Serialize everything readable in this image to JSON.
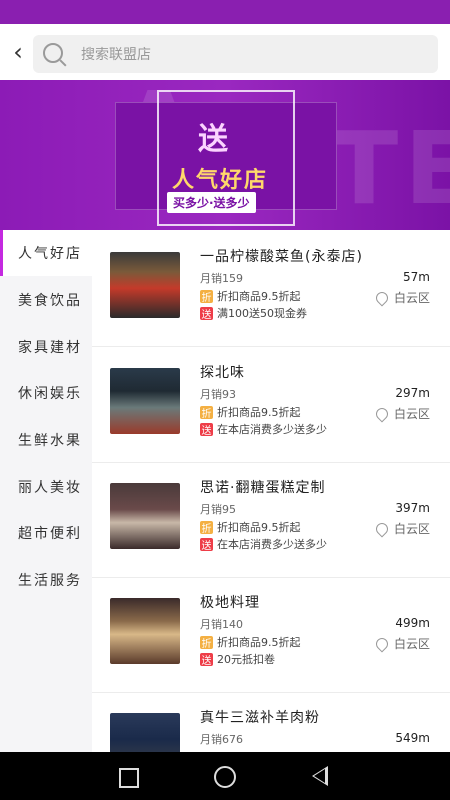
{
  "search": {
    "placeholder": "搜索联盟店"
  },
  "banner": {
    "badge": "送",
    "title": "人气好店",
    "subtitle": "买多少·送多少",
    "ghost_left": "A",
    "ghost_right": "TE"
  },
  "sidebar": {
    "items": [
      {
        "label": "人气好店",
        "active": true
      },
      {
        "label": "美食饮品"
      },
      {
        "label": "家具建材"
      },
      {
        "label": "休闲娱乐"
      },
      {
        "label": "生鲜水果"
      },
      {
        "label": "丽人美妆"
      },
      {
        "label": "超市便利"
      },
      {
        "label": "生活服务"
      }
    ]
  },
  "stores": [
    {
      "name": "一品柠檬酸菜鱼(永泰店)",
      "sold": "月销159",
      "zhe_label": "折",
      "discount": "折扣商品9.5折起",
      "song_label": "送",
      "gift": "满100送50现金券",
      "distance": "57m",
      "district": "白云区"
    },
    {
      "name": "探北味",
      "sold": "月销93",
      "zhe_label": "折",
      "discount": "折扣商品9.5折起",
      "song_label": "送",
      "gift": "在本店消费多少送多少",
      "distance": "297m",
      "district": "白云区"
    },
    {
      "name": "思诺·翻糖蛋糕定制",
      "sold": "月销95",
      "zhe_label": "折",
      "discount": "折扣商品9.5折起",
      "song_label": "送",
      "gift": "在本店消费多少送多少",
      "distance": "397m",
      "district": "白云区"
    },
    {
      "name": "极地料理",
      "sold": "月销140",
      "zhe_label": "折",
      "discount": "折扣商品9.5折起",
      "song_label": "送",
      "gift": "20元抵扣卷",
      "distance": "499m",
      "district": "白云区"
    },
    {
      "name": "真牛三滋补羊肉粉",
      "sold": "月销676",
      "distance": "549m"
    }
  ]
}
